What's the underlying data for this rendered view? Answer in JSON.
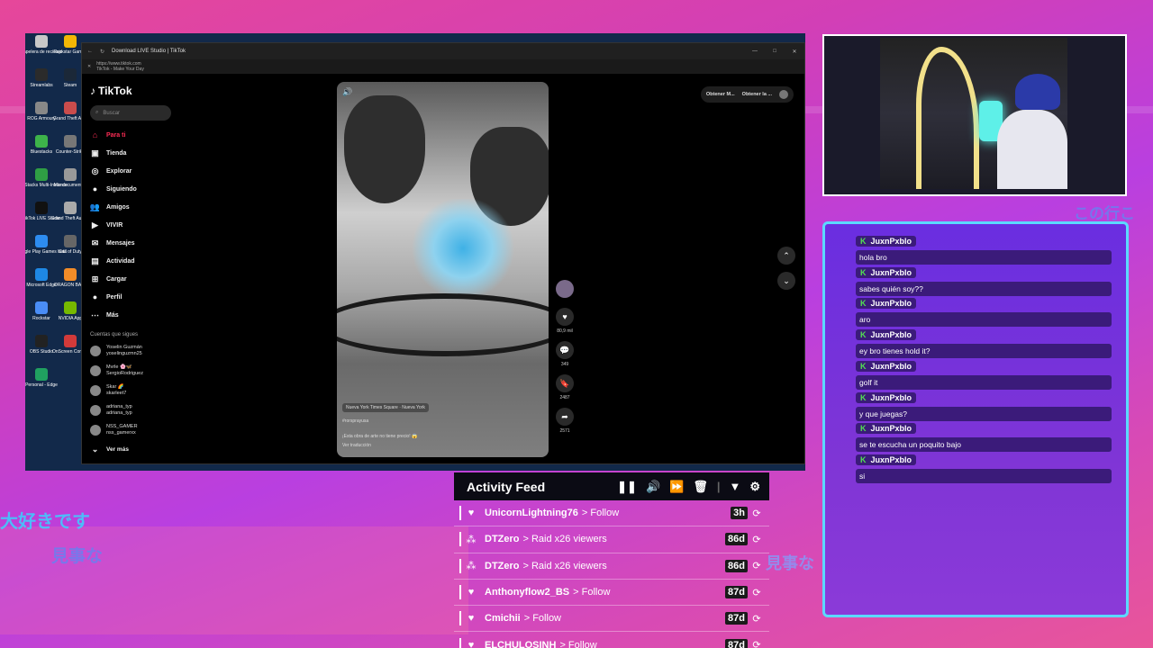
{
  "background": {
    "jp_texts": [
      "大好きです",
      "見事な",
      "見事な",
      "この行こ"
    ]
  },
  "desktop": {
    "icons": [
      {
        "label": "Papelera de reciclaje",
        "color": "#c8c8c8"
      },
      {
        "label": "Rockstar Games",
        "color": "#f2b705"
      },
      {
        "label": "Streamlabs",
        "color": "#2b2b2b"
      },
      {
        "label": "Steam",
        "color": "#1b2838"
      },
      {
        "label": "ROG Armoury",
        "color": "#888888"
      },
      {
        "label": "Grand Theft Auto",
        "color": "#c94c4c"
      },
      {
        "label": "Bluestacks",
        "color": "#3db34a"
      },
      {
        "label": "Counter-Strike",
        "color": "#777777"
      },
      {
        "label": "BlueStacks Multi-Instance",
        "color": "#2f9e44"
      },
      {
        "label": "Mis documentos",
        "color": "#999999"
      },
      {
        "label": "TikTok LIVE Studio",
        "color": "#111111"
      },
      {
        "label": "Grand Theft Auto V",
        "color": "#aaaaaa"
      },
      {
        "label": "Google Play Games beta",
        "color": "#2d8cf0"
      },
      {
        "label": "Call of Duty",
        "color": "#666666"
      },
      {
        "label": "Microsoft Edge",
        "color": "#1e88e5"
      },
      {
        "label": "DRAGON BALL",
        "color": "#f28c28"
      },
      {
        "label": "Rockstar",
        "color": "#4a8df6"
      },
      {
        "label": "NVIDIA App",
        "color": "#76b900"
      },
      {
        "label": "OBS Studio",
        "color": "#222222"
      },
      {
        "label": "OnScreen Control",
        "color": "#d23a3a"
      },
      {
        "label": "Personal - Edge",
        "color": "#20a060"
      }
    ]
  },
  "browser": {
    "tab_title": "Download LIVE Studio | TikTok",
    "url": "https://www.tiktok.com",
    "page_title": "TikTok - Make Your Day"
  },
  "tiktok": {
    "brand": "TikTok",
    "search_placeholder": "Buscar",
    "nav": [
      {
        "label": "Para ti",
        "icon": "⌂",
        "active": true
      },
      {
        "label": "Tienda",
        "icon": "▣",
        "active": false
      },
      {
        "label": "Explorar",
        "icon": "◎",
        "active": false
      },
      {
        "label": "Siguiendo",
        "icon": "●",
        "active": false
      },
      {
        "label": "Amigos",
        "icon": "👥",
        "active": false
      },
      {
        "label": "VIVIR",
        "icon": "▶",
        "active": false
      },
      {
        "label": "Mensajes",
        "icon": "✉",
        "active": false
      },
      {
        "label": "Actividad",
        "icon": "▤",
        "active": false
      },
      {
        "label": "Cargar",
        "icon": "⊞",
        "active": false
      },
      {
        "label": "Perfil",
        "icon": "●",
        "active": false
      },
      {
        "label": "Más",
        "icon": "⋯",
        "active": false
      }
    ],
    "following_title": "Cuentas que sigues",
    "following": [
      {
        "name": "Yoselin Guzmán",
        "handle": "yoselinguzmn25"
      },
      {
        "name": "Mvrle 🌸🦋",
        "handle": "SergioRodriguez"
      },
      {
        "name": "Skar 🌈",
        "handle": "skarleet7"
      },
      {
        "name": "adriana_typ",
        "handle": "adriana_typ"
      },
      {
        "name": "NSS_GAMER",
        "handle": "nss_gamerxx"
      }
    ],
    "see_more": "Ver más",
    "top_buttons": [
      "Obtener M...",
      "Obtener la ..."
    ],
    "video": {
      "location": "Nueva York Times Square · Nueva York",
      "user": "#rorsprayusa",
      "caption": "¡Esta obra de arte no tiene precio! 😱",
      "translate": "Ver traducción"
    },
    "rail": {
      "likes": "80,9 mil",
      "comments": "349",
      "saves": "2487",
      "shares": "2571"
    }
  },
  "chat": {
    "messages": [
      {
        "user": "JuxnPxblo",
        "text": "hola bro"
      },
      {
        "user": "JuxnPxblo",
        "text": "sabes quién soy??"
      },
      {
        "user": "JuxnPxblo",
        "text": "aro"
      },
      {
        "user": "JuxnPxblo",
        "text": "ey bro tienes hold it?"
      },
      {
        "user": "JuxnPxblo",
        "text": "golf it"
      },
      {
        "user": "JuxnPxblo",
        "text": "y que juegas?"
      },
      {
        "user": "JuxnPxblo",
        "text": "se te escucha un poquito bajo"
      },
      {
        "user": "JuxnPxblo",
        "text": "si"
      }
    ]
  },
  "feed": {
    "title": "Activity Feed",
    "rows": [
      {
        "icon": "heart-icon",
        "glyph": "♥",
        "user": "UnicornLightning76",
        "action": "> Follow",
        "age": "3h"
      },
      {
        "icon": "raid-icon",
        "glyph": "⁂",
        "user": "DTZero",
        "action": "> Raid x26 viewers",
        "age": "86d"
      },
      {
        "icon": "raid-icon",
        "glyph": "⁂",
        "user": "DTZero",
        "action": "> Raid x26 viewers",
        "age": "86d"
      },
      {
        "icon": "heart-icon",
        "glyph": "♥",
        "user": "Anthonyflow2_BS",
        "action": "> Follow",
        "age": "87d"
      },
      {
        "icon": "heart-icon",
        "glyph": "♥",
        "user": "Cmichii",
        "action": "> Follow",
        "age": "87d"
      },
      {
        "icon": "heart-icon",
        "glyph": "♥",
        "user": "ELCHULOSINH",
        "action": "> Follow",
        "age": "87d"
      }
    ]
  }
}
